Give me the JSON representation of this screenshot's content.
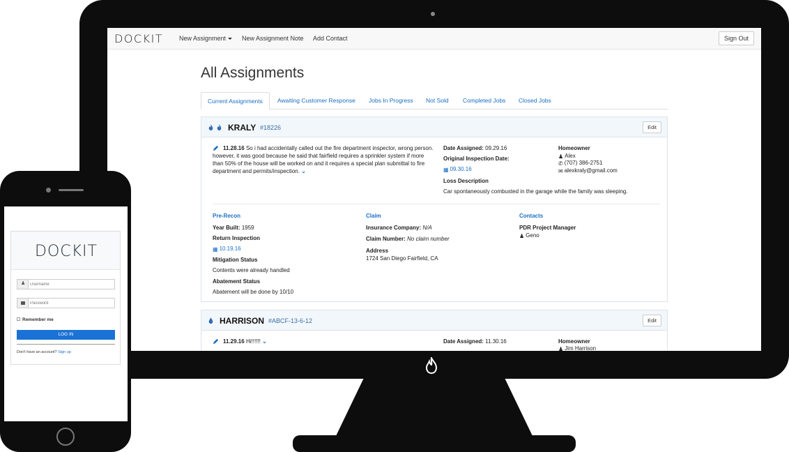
{
  "app": {
    "brand": "DOCKIT",
    "nav": {
      "new_assignment": "New Assignment",
      "new_assignment_note": "New Assignment Note",
      "add_contact": "Add Contact",
      "sign_out": "Sign Out"
    }
  },
  "page": {
    "title": "All Assignments",
    "tabs": [
      "Current Assignments",
      "Awaiting Customer Response",
      "Jobs In Progress",
      "Not Sold",
      "Completed Jobs",
      "Closed Jobs"
    ],
    "active_tab": "Current Assignments"
  },
  "assignments": [
    {
      "name": "KRALY",
      "number": "#18226",
      "edit_label": "Edit",
      "note": {
        "date": "11.28.16",
        "text": "So i had accidentally called out the fire department inspector, wrong person. however, it was good because he said that fairfield requires a sprinkler system if more than 50% of the house will be worked on and it requires a special plan submittal to fire department and permits/inspection."
      },
      "date_assigned_label": "Date Assigned:",
      "date_assigned": "09.29.16",
      "original_inspection_label": "Original Inspection Date:",
      "original_inspection_date": "09.30.16",
      "loss_description_label": "Loss Description",
      "loss_description": "Car spontaneously combusted in the garage while the family was sleeping.",
      "homeowner_label": "Homeowner",
      "homeowner_name": "Alex",
      "homeowner_phone": "(707) 386-2751",
      "homeowner_email": "alexkraly@gmail.com",
      "pre_recon": {
        "heading": "Pre-Recon",
        "year_built_label": "Year Built:",
        "year_built": "1959",
        "return_inspection_label": "Return Inspection",
        "return_inspection": "10.19.16",
        "mitigation_label": "Mitigation Status",
        "mitigation": "Contents were already handled",
        "abatement_label": "Abatement Status",
        "abatement": "Abatement will be done by 10/10"
      },
      "claim": {
        "heading": "Claim",
        "insurance_label": "Insurance Company:",
        "insurance": "N/A",
        "claim_number_label": "Claim Number:",
        "claim_number": "No claim number",
        "address_label": "Address",
        "address": "1724 San Diego Fairfield, CA"
      },
      "contacts": {
        "heading": "Contacts",
        "role": "PDR Project Manager",
        "name": "Geno"
      }
    },
    {
      "name": "HARRISON",
      "number": "#ABCF-13-6-12",
      "edit_label": "Edit",
      "note": {
        "date": "11.29.16",
        "text": "Hi!!!!!!"
      },
      "date_assigned_label": "Date Assigned:",
      "date_assigned": "11.30.16",
      "homeowner_label": "Homeowner",
      "homeowner_name": "Jim Harrison"
    }
  ],
  "phone_login": {
    "logo": "DOCKIT",
    "username_placeholder": "Username",
    "password_placeholder": "Password",
    "remember_me": "Remember me",
    "login_button": "LOG IN",
    "no_account_text": "Don't have an account?",
    "sign_up_link": "Sign up"
  }
}
